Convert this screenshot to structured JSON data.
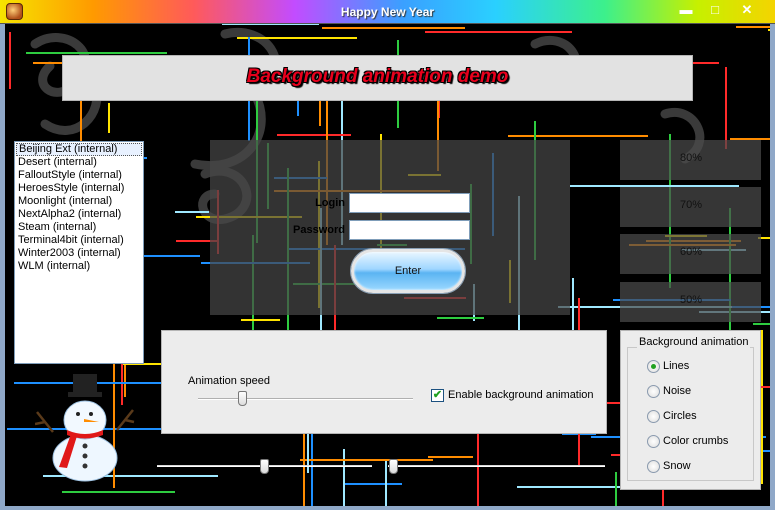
{
  "window": {
    "title": "Happy New Year",
    "minimize": "▬",
    "maximize": "□",
    "close": "✕"
  },
  "header": {
    "title": "Background animation demo"
  },
  "skins": {
    "selected": 0,
    "items": [
      "Beijing Ext (internal)",
      "Desert (internal)",
      "FalloutStyle (internal)",
      "HeroesStyle (internal)",
      "Moonlight (internal)",
      "NextAlpha2 (internal)",
      "Steam (internal)",
      "Terminal4bit (internal)",
      "Winter2003 (internal)",
      "WLM (internal)"
    ]
  },
  "login": {
    "login_label": "Login",
    "password_label": "Password",
    "login_value": "",
    "password_value": "",
    "enter_label": "Enter"
  },
  "opacity_panels": [
    "80%",
    "70%",
    "60%",
    "50%"
  ],
  "speed": {
    "label": "Animation speed",
    "value_fraction": 0.2,
    "enable_label": "Enable background animation",
    "enabled": true
  },
  "animation": {
    "title": "Background animation",
    "options": [
      "Lines",
      "Noise",
      "Circles",
      "Color crumbs",
      "Snow"
    ],
    "selected": "Lines"
  },
  "bottom_sliders": [
    {
      "value_fraction": 0.48
    },
    {
      "value_fraction": 0.01
    }
  ],
  "colors": {
    "line_palette": [
      "#1e90ff",
      "#ff2a2a",
      "#ffe400",
      "#2ecc40",
      "#ff8c00",
      "#9fe8ff"
    ],
    "header_title": "#e8001c"
  },
  "icons": {
    "app": "app-icon",
    "snowman": "snowman-icon",
    "check": "✔"
  }
}
